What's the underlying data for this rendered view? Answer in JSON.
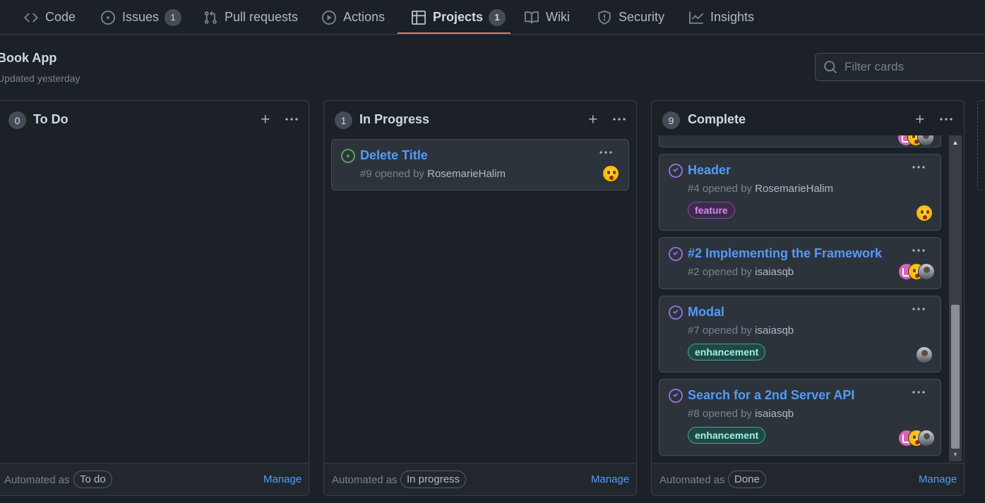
{
  "nav": {
    "tabs": [
      {
        "label": "Code",
        "icon": "code-icon"
      },
      {
        "label": "Issues",
        "icon": "issue-opened-icon",
        "count": "1"
      },
      {
        "label": "Pull requests",
        "icon": "git-pull-request-icon"
      },
      {
        "label": "Actions",
        "icon": "play-icon"
      },
      {
        "label": "Projects",
        "icon": "table-icon",
        "count": "1",
        "selected": true
      },
      {
        "label": "Wiki",
        "icon": "book-icon"
      },
      {
        "label": "Security",
        "icon": "shield-icon"
      },
      {
        "label": "Insights",
        "icon": "graph-icon"
      }
    ],
    "selected_underline_color": "#ec775c"
  },
  "project": {
    "title": "Book App",
    "updated": "Updated yesterday"
  },
  "filter": {
    "placeholder": "Filter cards"
  },
  "columns": [
    {
      "name": "To Do",
      "count": "0",
      "automated_label": "Automated as",
      "automated_value": "To do",
      "manage": "Manage",
      "cards": []
    },
    {
      "name": "In Progress",
      "count": "1",
      "automated_label": "Automated as",
      "automated_value": "In progress",
      "manage": "Manage",
      "cards": [
        {
          "title": "Delete Title",
          "number": "#9",
          "opened_by": "opened by",
          "author": "RosemarieHalim",
          "state": "open",
          "labels": [],
          "avatars": [
            "emoji"
          ]
        }
      ]
    },
    {
      "name": "Complete",
      "count": "9",
      "automated_label": "Automated as",
      "automated_value": "Done",
      "manage": "Manage",
      "cards": [
        {
          "title": "Header",
          "number": "#4",
          "opened_by": "opened by",
          "author": "RosemarieHalim",
          "state": "closed",
          "labels": [
            "feature"
          ],
          "avatars": [
            "emoji"
          ]
        },
        {
          "title": "#2 Implementing the Framework",
          "number": "#2",
          "opened_by": "opened by",
          "author": "isaiasqb",
          "state": "closed",
          "labels": [],
          "avatars": [
            "pink",
            "emoji",
            "photo"
          ]
        },
        {
          "title": "Modal",
          "number": "#7",
          "opened_by": "opened by",
          "author": "isaiasqb",
          "state": "closed",
          "labels": [
            "enhancement"
          ],
          "avatars": [
            "photo"
          ]
        },
        {
          "title": "Search for a 2nd Server API",
          "number": "#8",
          "opened_by": "opened by",
          "author": "isaiasqb",
          "state": "closed",
          "labels": [
            "enhancement"
          ],
          "avatars": [
            "pink",
            "emoji",
            "photo"
          ]
        }
      ]
    }
  ],
  "colors": {
    "background": "#1c2128",
    "card": "#2d333b",
    "link": "#539bf5",
    "open_icon": "#57ab5a",
    "closed_icon": "#986ee2"
  }
}
